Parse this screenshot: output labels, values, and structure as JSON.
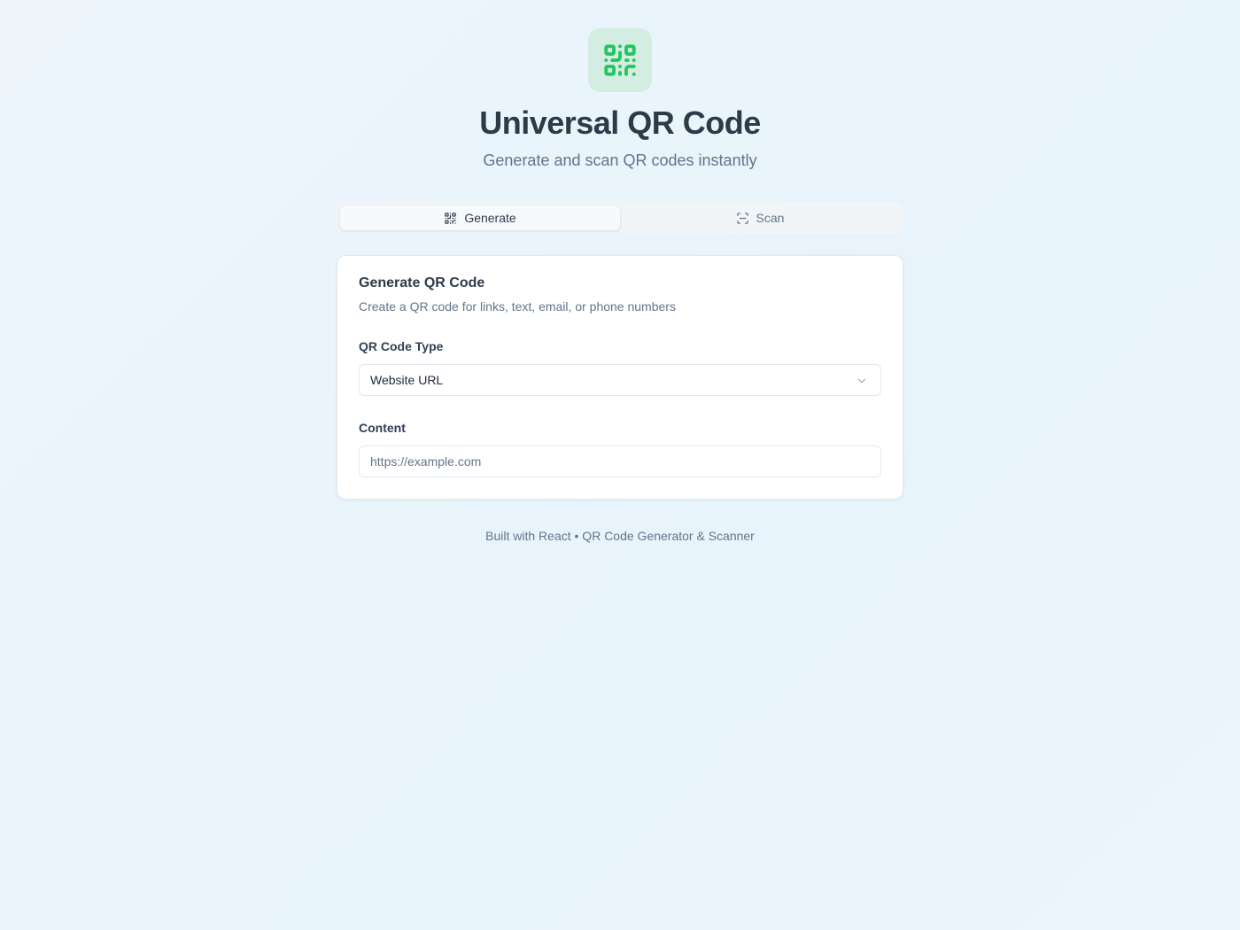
{
  "header": {
    "logo_icon": "qr-code-icon",
    "title": "Universal QR Code",
    "subtitle": "Generate and scan QR codes instantly"
  },
  "tabs": [
    {
      "label": "Generate",
      "icon": "qr-code-icon",
      "active": true
    },
    {
      "label": "Scan",
      "icon": "scan-icon",
      "active": false
    }
  ],
  "card": {
    "title": "Generate QR Code",
    "description": "Create a QR code for links, text, email, or phone numbers",
    "type_label": "QR Code Type",
    "type_value": "Website URL",
    "content_label": "Content",
    "content_value": "",
    "content_placeholder": "https://example.com"
  },
  "footer": {
    "text": "Built with React • QR Code Generator & Scanner"
  },
  "colors": {
    "accent": "#22c55e",
    "logo_bg": "#d3ede2",
    "title": "#2d3a48",
    "muted": "#64748b"
  }
}
